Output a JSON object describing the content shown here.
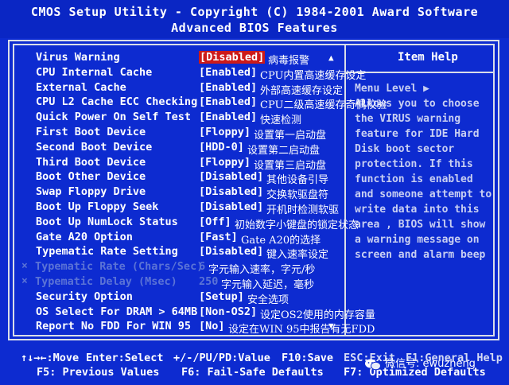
{
  "header": {
    "title": "CMOS Setup Utility - Copyright (C) 1984-2001 Award Software",
    "subtitle": "Advanced BIOS Features"
  },
  "settings": [
    {
      "label": "Virus Warning",
      "value": "[Disabled]",
      "note": "病毒报警",
      "selected": true,
      "dim": false
    },
    {
      "label": "CPU Internal Cache",
      "value": "[Enabled]",
      "note": "CPU内置高速缓存设定",
      "selected": false,
      "dim": false
    },
    {
      "label": "External Cache",
      "value": "[Enabled]",
      "note": "外部高速缓存设定",
      "selected": false,
      "dim": false
    },
    {
      "label": "CPU L2 Cache ECC Checking",
      "value": "[Enabled]",
      "note": "CPU二级高速缓存奇偶校验",
      "selected": false,
      "dim": false
    },
    {
      "label": "Quick Power On Self Test",
      "value": "[Enabled]",
      "note": "快速检测",
      "selected": false,
      "dim": false
    },
    {
      "label": "First Boot Device",
      "value": "[Floppy]",
      "note": "设置第一启动盘",
      "selected": false,
      "dim": false
    },
    {
      "label": "Second Boot Device",
      "value": "[HDD-0]",
      "note": "设置第二启动盘",
      "selected": false,
      "dim": false
    },
    {
      "label": "Third Boot Device",
      "value": "[Floppy]",
      "note": "设置第三启动盘",
      "selected": false,
      "dim": false
    },
    {
      "label": "Boot Other Device",
      "value": "[Disabled]",
      "note": "其他设备引导",
      "selected": false,
      "dim": false
    },
    {
      "label": "Swap Floppy Drive",
      "value": "[Disabled]",
      "note": "交换软驱盘符",
      "selected": false,
      "dim": false
    },
    {
      "label": "Boot Up Floppy Seek",
      "value": "[Disabled]",
      "note": "开机时检测软驱",
      "selected": false,
      "dim": false
    },
    {
      "label": "Boot Up NumLock Status",
      "value": "[Off]",
      "note": "初始数字小键盘的锁定状态",
      "selected": false,
      "dim": false
    },
    {
      "label": "Gate A20 Option",
      "value": "[Fast]",
      "note": "Gate A20的选择",
      "selected": false,
      "dim": false
    },
    {
      "label": "Typematic Rate Setting",
      "value": "[Disabled]",
      "note": "键入速率设定",
      "selected": false,
      "dim": false
    },
    {
      "label": "Typematic Rate (Chars/Sec)",
      "value": "6",
      "note": "字元输入速率，字元/秒",
      "selected": false,
      "dim": true
    },
    {
      "label": "Typematic Delay (Msec)",
      "value": "250",
      "note": "字元输入延迟，毫秒",
      "selected": false,
      "dim": true
    },
    {
      "label": "Security Option",
      "value": "[Setup]",
      "note": "安全选项",
      "selected": false,
      "dim": false
    },
    {
      "label": "OS Select For DRAM > 64MB",
      "value": "[Non-OS2]",
      "note": "设定OS2使用的内存容量",
      "selected": false,
      "dim": false
    },
    {
      "label": "Report No FDD For WIN 95",
      "value": "[No]",
      "note": "设定在WIN 95中报告有无FDD",
      "selected": false,
      "dim": false
    }
  ],
  "help": {
    "title": "Item Help",
    "lines": [
      "Menu Level   ▶",
      "Allows you to choose",
      "the VIRUS warning",
      "feature for IDE Hard",
      "Disk boot sector",
      "protection. If this",
      "function is enabled",
      "and someone attempt to",
      "write data into this",
      "area , BIOS will show",
      "a warning message on",
      "screen and alarm beep"
    ]
  },
  "scroll": {
    "up": "▲",
    "down": "▼"
  },
  "footer": {
    "move": "↑↓→←:Move",
    "enter": "Enter:Select",
    "pu_pd": "+/-/PU/PD:Value",
    "f10": "F10:Save",
    "esc": "ESC:Exit",
    "f1": "F1:General Help",
    "f5": "F5: Previous Values",
    "f6": "F6: Fail-Safe Defaults",
    "f7": "F7: Optimized Defaults"
  },
  "watermark": {
    "text": "微信号: ewuzheng"
  }
}
